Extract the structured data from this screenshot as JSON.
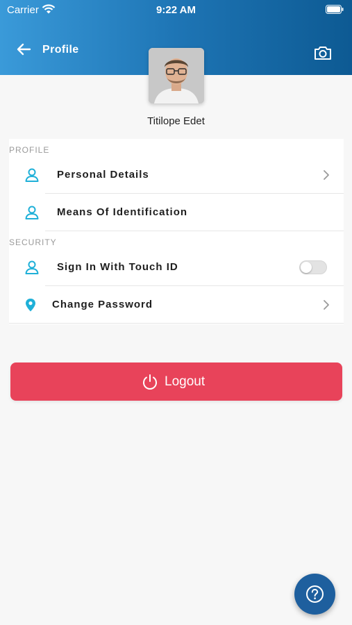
{
  "status_bar": {
    "carrier": "Carrier",
    "time": "9:22 AM"
  },
  "header": {
    "title": "Profile",
    "back_icon": "arrow-left-icon",
    "camera_icon": "camera-icon"
  },
  "user": {
    "name": "Titilope Edet"
  },
  "sections": {
    "profile": {
      "label": "PROFILE",
      "items": [
        {
          "label": "Personal Details",
          "icon": "user-icon",
          "trailing": "chevron"
        },
        {
          "label": "Means Of Identification",
          "icon": "user-icon",
          "trailing": "none"
        }
      ]
    },
    "security": {
      "label": "SECURITY",
      "items": [
        {
          "label": "Sign In With Touch ID",
          "icon": "user-icon",
          "trailing": "toggle",
          "toggle_on": false
        },
        {
          "label": "Change Password",
          "icon": "location-pin-icon",
          "trailing": "chevron"
        }
      ]
    }
  },
  "logout": {
    "label": "Logout",
    "icon": "power-icon"
  },
  "help": {
    "icon": "help-icon"
  },
  "colors": {
    "accent": "#1fb0d8",
    "logout": "#e8435a",
    "fab": "#1e5f9e"
  }
}
